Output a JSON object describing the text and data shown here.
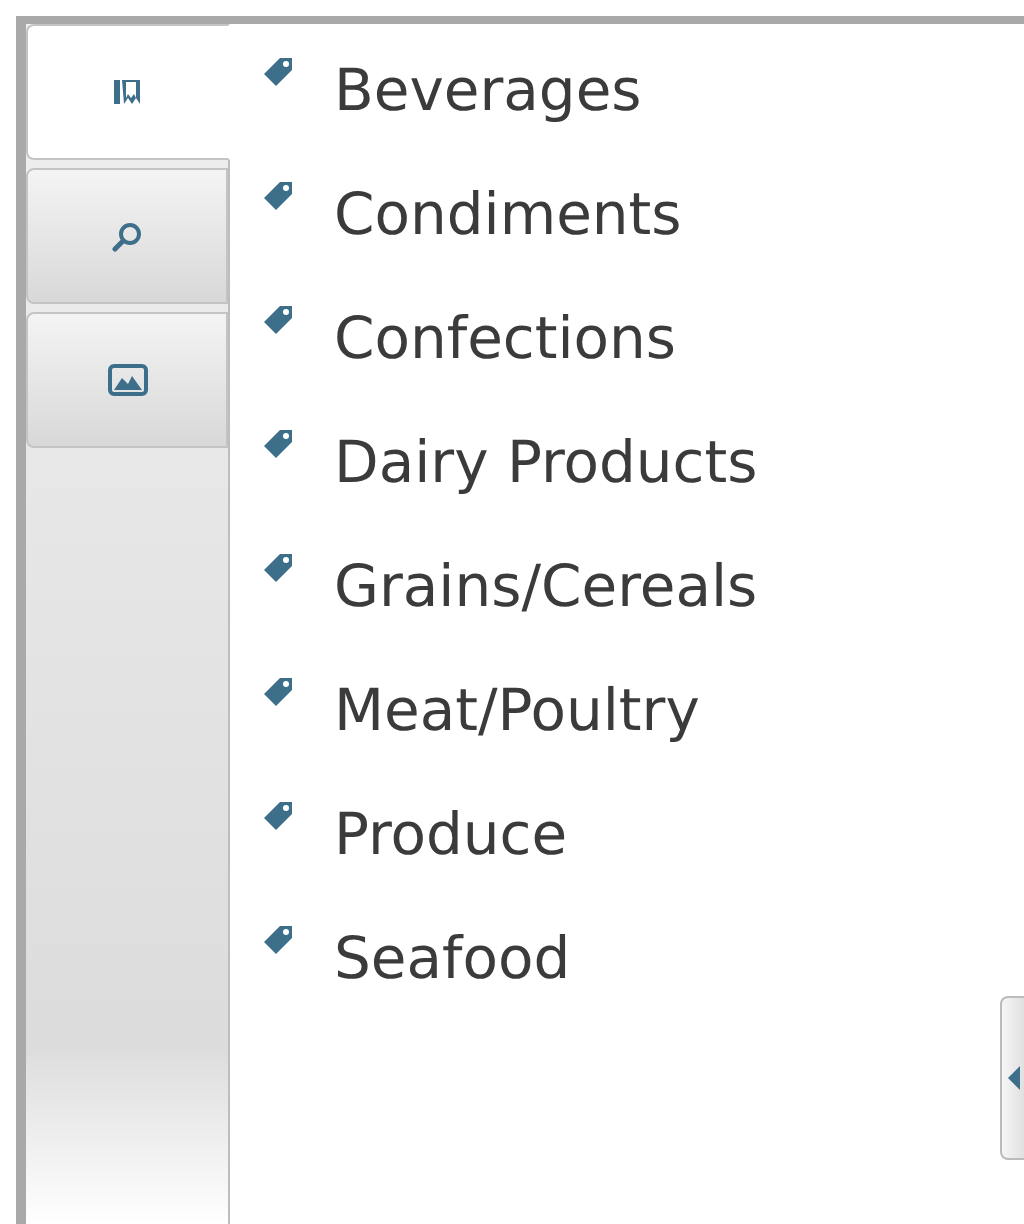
{
  "tabs": [
    {
      "kind": "bookmarks",
      "selected": true
    },
    {
      "kind": "search",
      "selected": false
    },
    {
      "kind": "image",
      "selected": false
    }
  ],
  "categories": [
    {
      "label": "Beverages"
    },
    {
      "label": "Condiments"
    },
    {
      "label": "Confections"
    },
    {
      "label": "Dairy Products"
    },
    {
      "label": "Grains/Cereals"
    },
    {
      "label": "Meat/Poultry"
    },
    {
      "label": "Produce"
    },
    {
      "label": "Seafood"
    }
  ]
}
